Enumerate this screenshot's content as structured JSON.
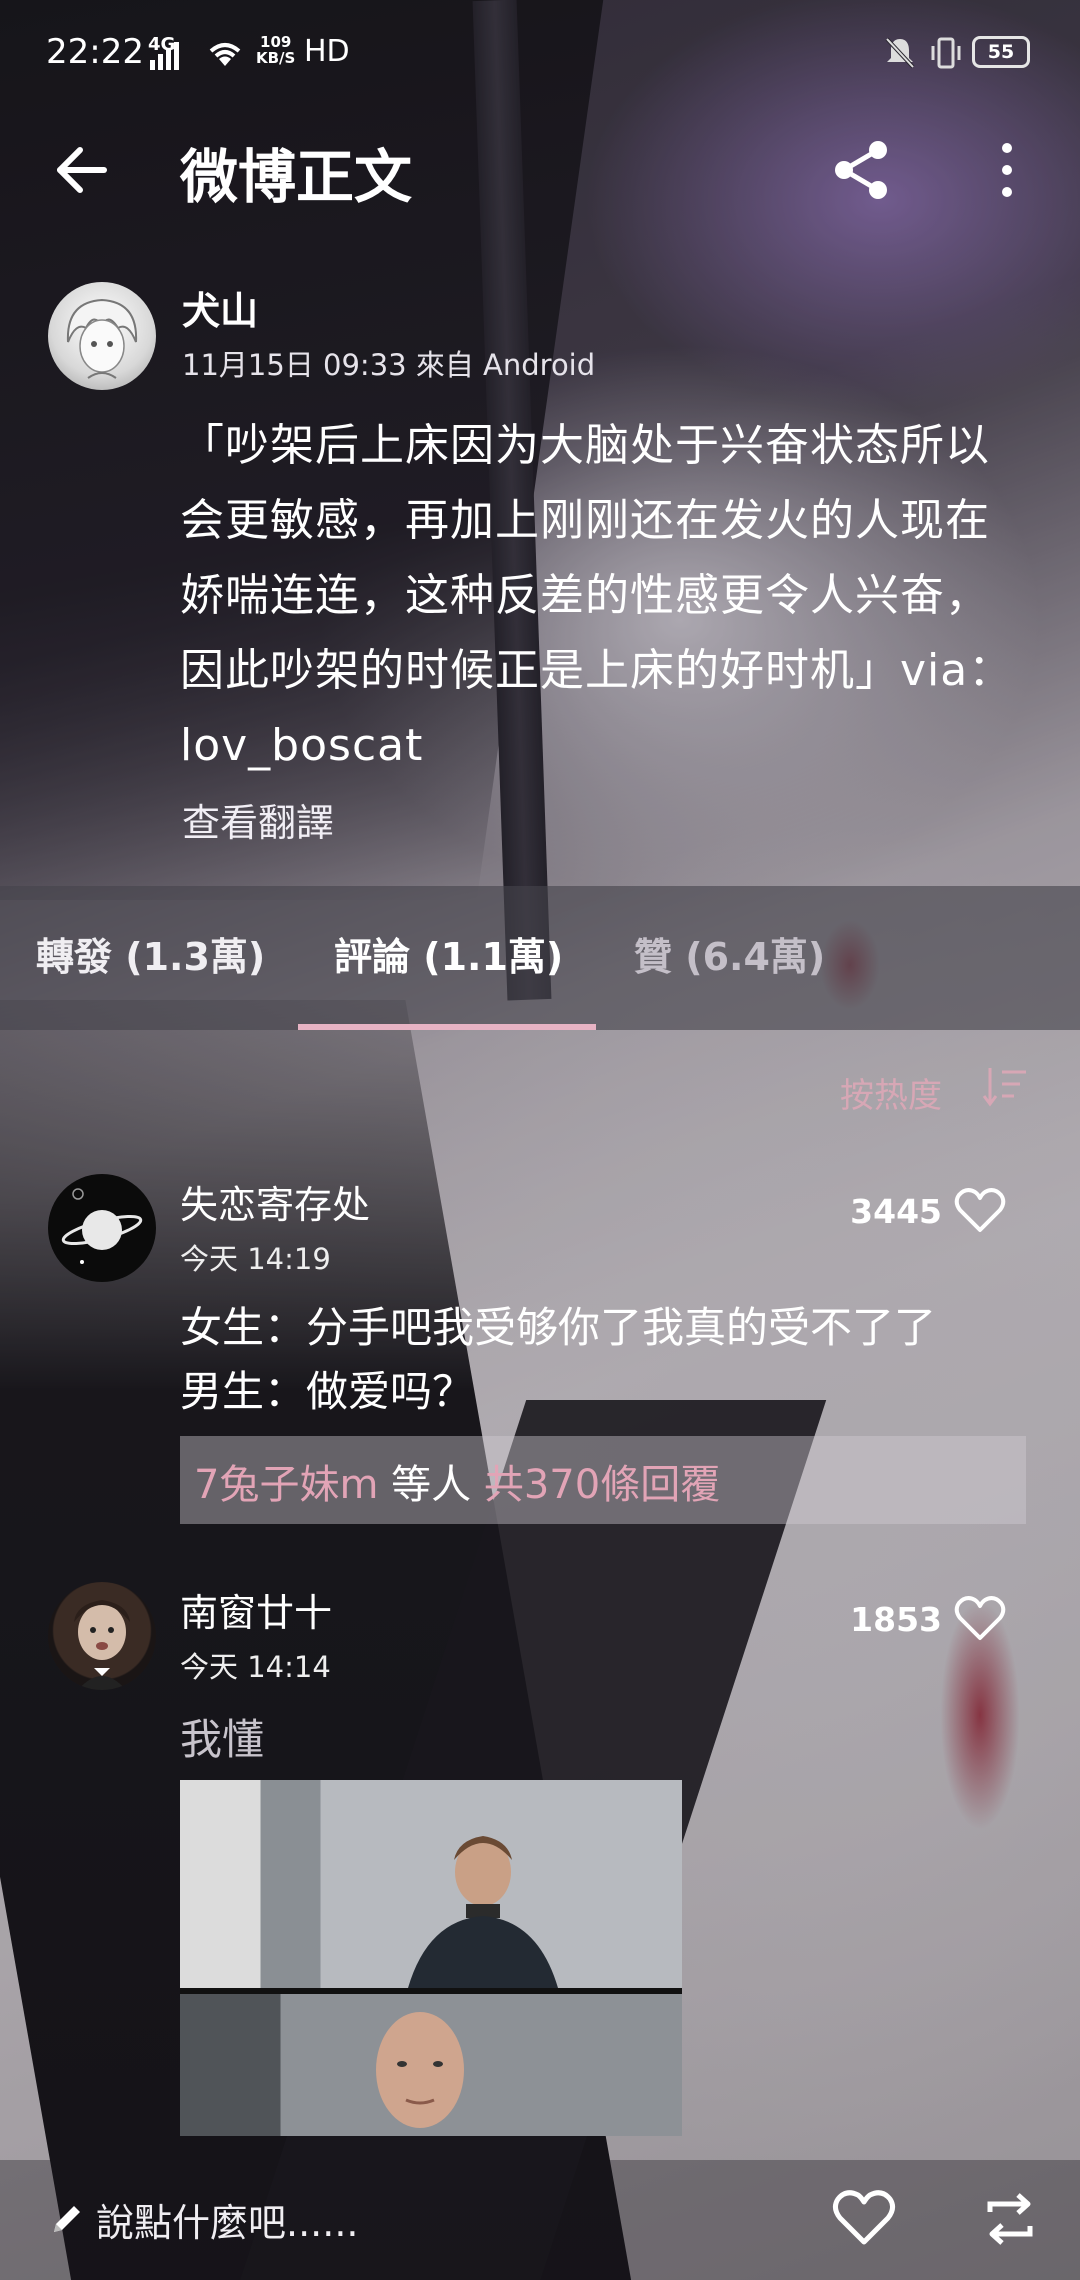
{
  "status_bar": {
    "time": "22:22",
    "network": "4G",
    "speed_value": "109",
    "speed_unit": "KB/S",
    "hd": "HD",
    "battery": "55",
    "icons": [
      "signal-icon",
      "wifi-icon",
      "mute-icon",
      "vibrate-icon",
      "battery-icon"
    ]
  },
  "header": {
    "title": "微博正文",
    "icons": [
      "back-arrow-icon",
      "share-icon",
      "more-vert-icon"
    ]
  },
  "post": {
    "author": "犬山",
    "meta": "11月15日 09:33 來自 Android",
    "body": "「吵架后上床因为大脑处于兴奋状态所以会更敏感，再加上刚刚还在发火的人现在娇喘连连，这种反差的性感更令人兴奋，因此吵架的时候正是上床的好时机」via：lov_boscat",
    "translate": "查看翻譯"
  },
  "tabs": {
    "reposts": "轉發 (1.3萬)",
    "comments": "評論 (1.1萬)",
    "likes": "贊 (6.4萬)",
    "active": "comments"
  },
  "sort": {
    "label": "按热度",
    "icon": "sort-icon"
  },
  "comments": [
    {
      "author": "失恋寄存处",
      "time": "今天 14:19",
      "likes": "3445",
      "text_line1": "女生：分手吧我受够你了我真的受不了了",
      "text_line2": "男生：做爱吗？",
      "replies_names": "7兔子妹m",
      "replies_mid": " 等人 ",
      "replies_count": "共370條回覆"
    },
    {
      "author": "南窗廿十",
      "time": "今天 14:14",
      "likes": "1853",
      "text": "我懂"
    }
  ],
  "bottom_bar": {
    "placeholder": "說點什麼吧......",
    "icons": [
      "pencil-icon",
      "heart-icon",
      "repost-icon"
    ]
  },
  "colors": {
    "accent_pink": "#e7b3c4",
    "sort_pink": "#d7a7b5",
    "replies_pink": "#e2a4b6"
  }
}
